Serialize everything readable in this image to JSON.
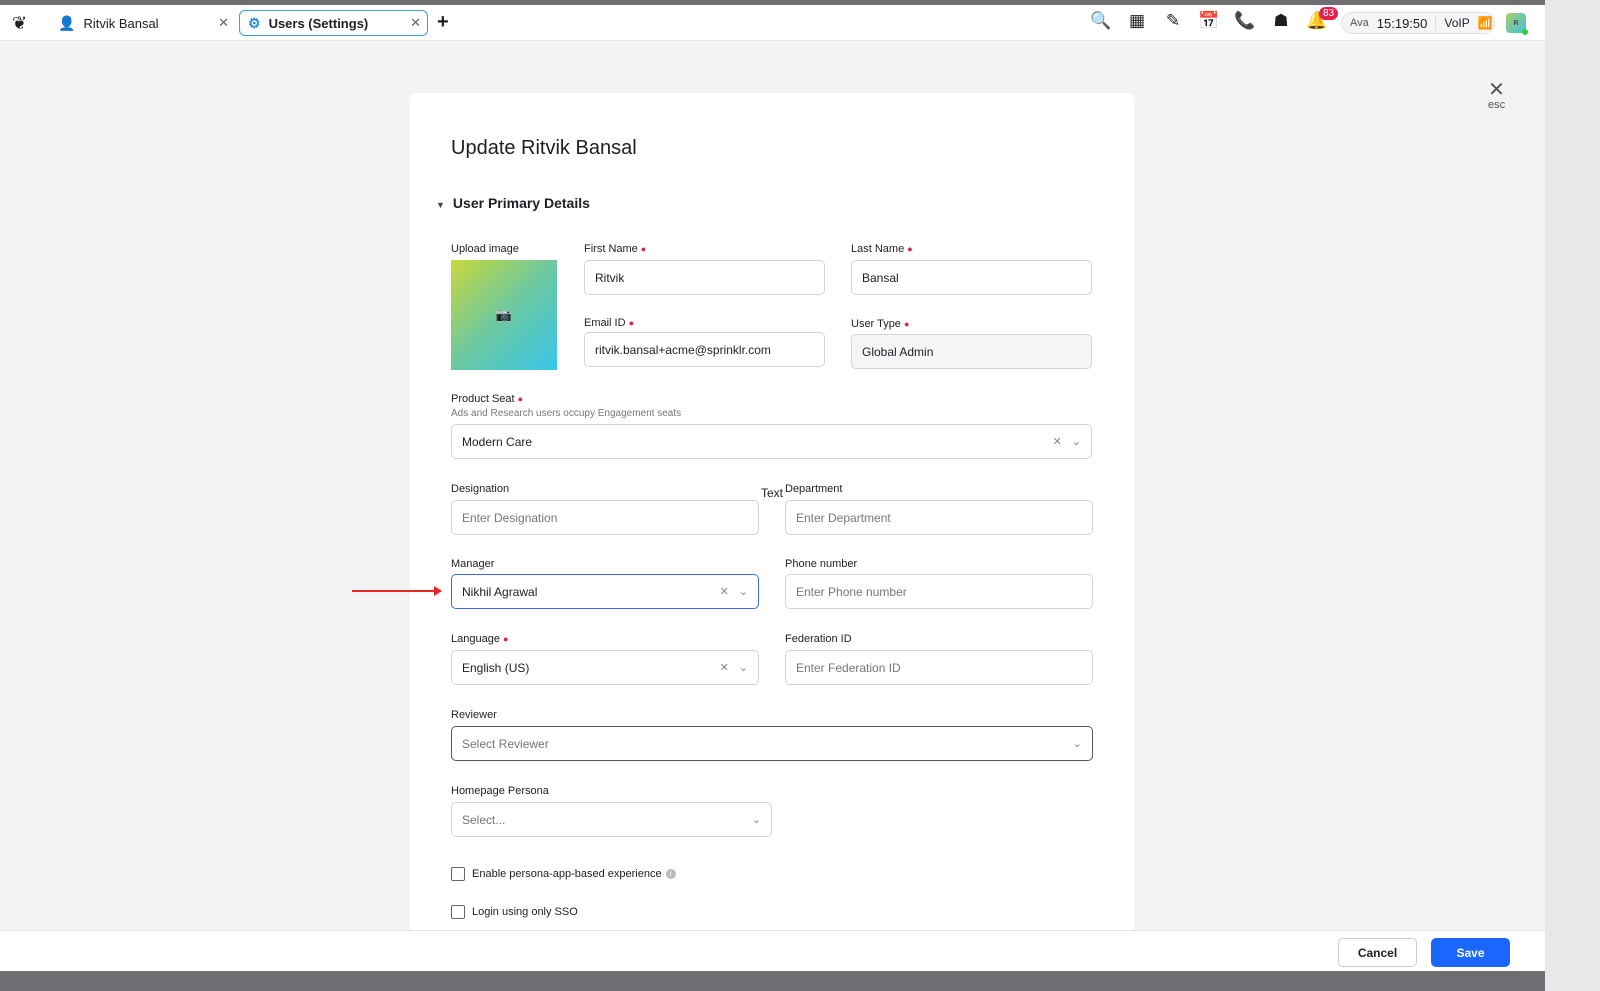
{
  "tabs": [
    {
      "label": "Ritvik Bansal",
      "icon": "user-icon"
    },
    {
      "label": "Users (Settings)",
      "icon": "gear-icon"
    }
  ],
  "toolbar": {
    "notifications_count": "83",
    "status_user": "Ava",
    "time": "15:19:50",
    "voip": "VoIP",
    "avatar_initial": "R"
  },
  "close": {
    "label": "esc"
  },
  "form": {
    "title": "Update Ritvik Bansal",
    "section": "User Primary Details",
    "upload_label": "Upload image",
    "first_name": {
      "label": "First Name",
      "value": "Ritvik"
    },
    "last_name": {
      "label": "Last Name",
      "value": "Bansal"
    },
    "email": {
      "label": "Email ID",
      "value": "ritvik.bansal+acme@sprinklr.com"
    },
    "user_type": {
      "label": "User Type",
      "value": "Global Admin"
    },
    "product_seat": {
      "label": "Product Seat",
      "hint": "Ads and Research users occupy Engagement seats",
      "value": "Modern Care"
    },
    "designation": {
      "label": "Designation",
      "placeholder": "Enter Designation"
    },
    "floating_text": "Text",
    "department": {
      "label": "Department",
      "placeholder": "Enter Department"
    },
    "manager": {
      "label": "Manager",
      "value": "Nikhil Agrawal"
    },
    "phone": {
      "label": "Phone number",
      "placeholder": "Enter Phone number"
    },
    "language": {
      "label": "Language",
      "value": "English (US)"
    },
    "federation": {
      "label": "Federation ID",
      "placeholder": "Enter Federation ID"
    },
    "reviewer": {
      "label": "Reviewer",
      "placeholder": "Select Reviewer"
    },
    "persona": {
      "label": "Homepage Persona",
      "placeholder": "Select..."
    },
    "checkboxes": [
      {
        "label": "Enable persona-app-based experience",
        "checked": false
      },
      {
        "label": "Login using only SSO",
        "checked": false
      }
    ]
  },
  "footer": {
    "cancel": "Cancel",
    "save": "Save"
  },
  "colors": {
    "accent": "#1a66ff",
    "required": "#e3204e",
    "annotation_arrow": "#e8281e"
  }
}
